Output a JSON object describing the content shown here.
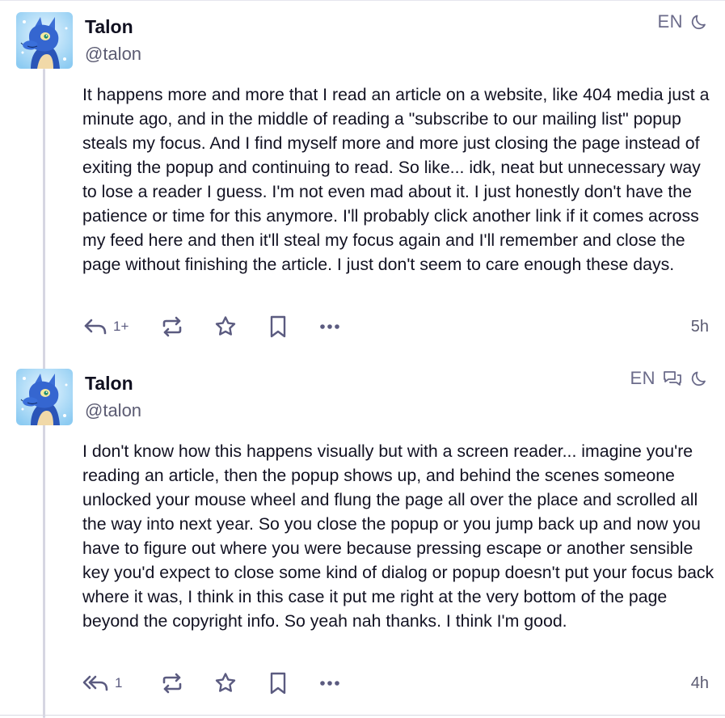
{
  "posts": [
    {
      "author": {
        "display_name": "Talon",
        "handle": "@talon"
      },
      "language": "EN",
      "content": "It happens more and more that I read an article on a website, like 404 media just a minute ago, and in the middle of reading a \"subscribe to our mailing list\" popup steals my focus. And I find myself more and more just closing the page instead of exiting the popup and continuing to read. So like... idk, neat but unnecessary way to lose a reader I guess. I'm not even mad about it. I just honestly don't have the patience or time for this anymore. I'll probably click another link if it comes across my feed here and then it'll steal my focus again and I'll remember and close the page without finishing the article. I just don't seem to care enough these days.",
      "reply_count": "1+",
      "time": "5h",
      "icons": {
        "reply": "reply-icon",
        "boost": "boost-icon",
        "favourite": "star-icon",
        "bookmark": "bookmark-icon",
        "more": "more-icon",
        "visibility": "moon-icon"
      }
    },
    {
      "author": {
        "display_name": "Talon",
        "handle": "@talon"
      },
      "language": "EN",
      "content": "I don't know how this happens visually but with a screen reader... imagine you're reading an article, then the popup shows up, and behind the scenes someone unlocked your mouse wheel and flung the page all over the place and scrolled all the way into next year. So you close the popup or you jump back up and now you have to figure out where you were because pressing escape or another sensible key you'd expect to close some kind of dialog or popup doesn't put your focus back where it was, I think in this case it put me right at the very bottom of the page beyond the copyright info. So yeah nah thanks. I think I'm good.",
      "reply_count": "1",
      "time": "4h",
      "icons": {
        "reply": "reply-all-icon",
        "boost": "boost-icon",
        "favourite": "star-icon",
        "bookmark": "bookmark-icon",
        "more": "more-icon",
        "thread": "conversation-icon",
        "visibility": "moon-icon"
      }
    }
  ],
  "colors": {
    "text": "#121222",
    "muted": "#5b5b80",
    "thread_line": "#d6d6e2",
    "avatar_bg": "#9ed4f5",
    "avatar_dragon": "#2e5fc9"
  }
}
